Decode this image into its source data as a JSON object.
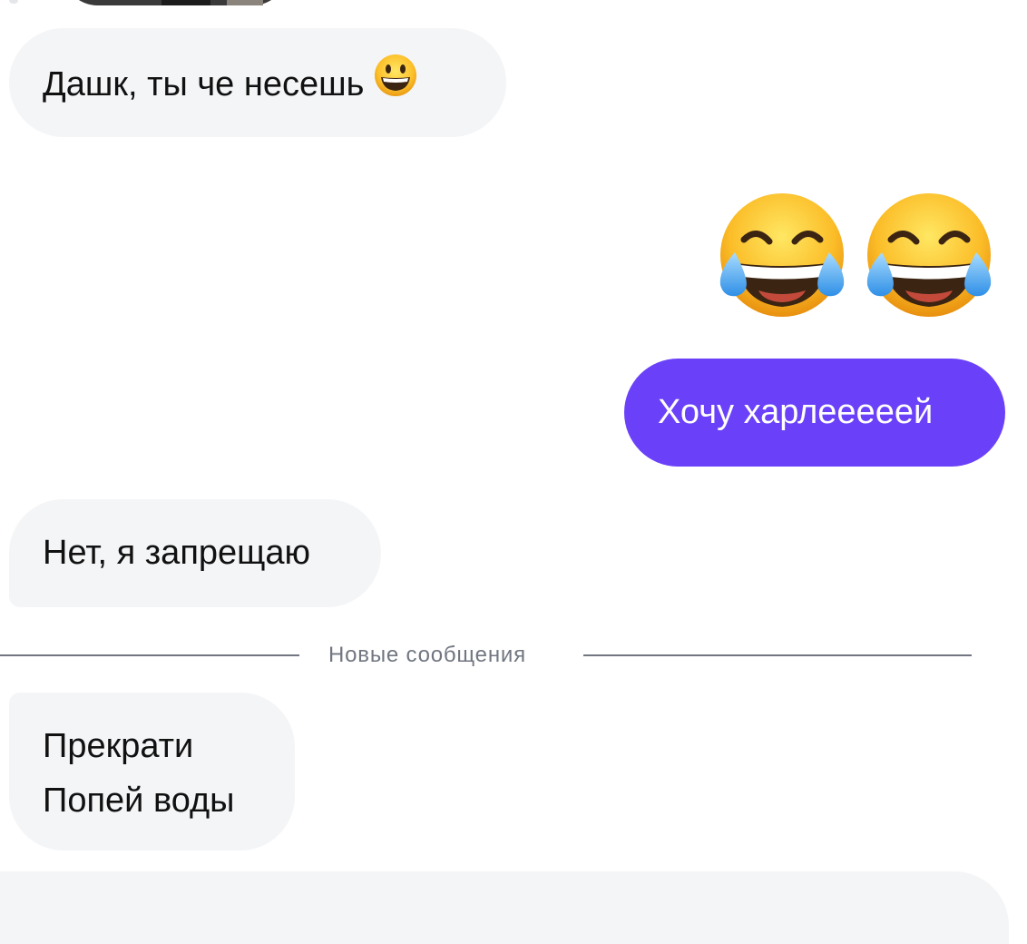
{
  "messages": [
    {
      "direction": "incoming",
      "text": "Дашк, ты че несешь",
      "emoji": "grinning-face"
    },
    {
      "direction": "outgoing",
      "emoji_only": [
        "face-with-tears-of-joy",
        "face-with-tears-of-joy"
      ]
    },
    {
      "direction": "outgoing",
      "text": "Хочу харлееееей"
    },
    {
      "direction": "incoming",
      "text": "Нет, я запрещаю"
    },
    {
      "direction": "incoming",
      "lines": [
        "Прекрати",
        "Попей воды"
      ]
    }
  ],
  "divider": {
    "label": "Новые сообщения"
  },
  "colors": {
    "incoming_bubble": "#f4f5f7",
    "outgoing_bubble": "#6a41f9",
    "divider": "#717681"
  }
}
